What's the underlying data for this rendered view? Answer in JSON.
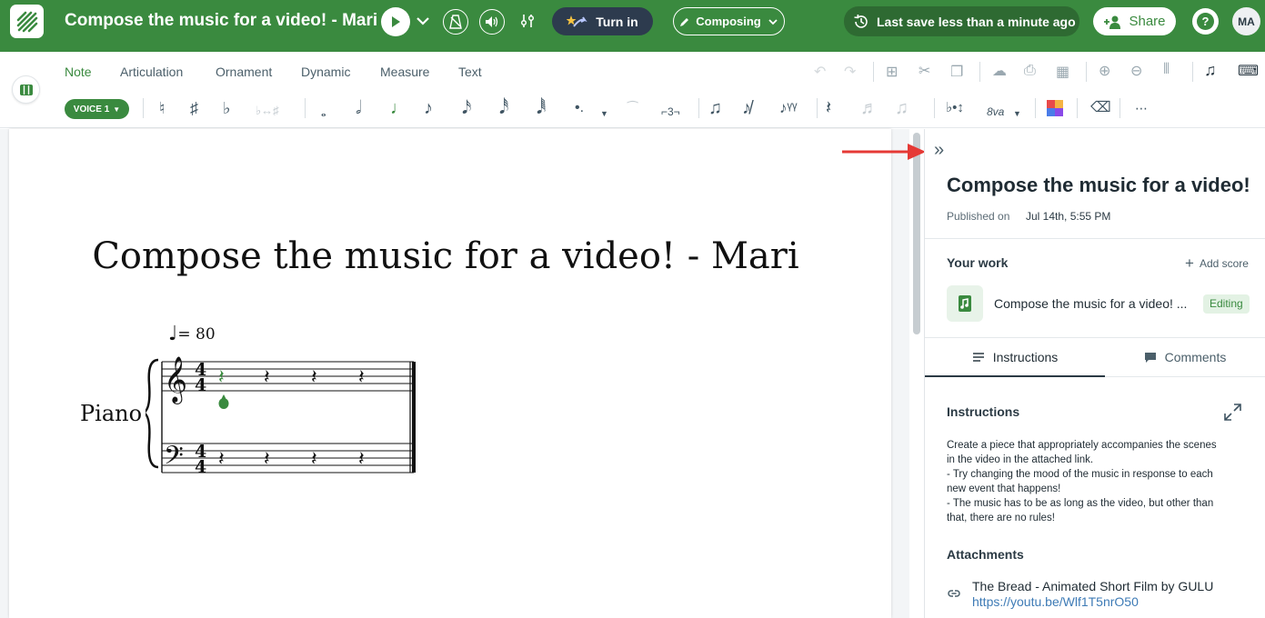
{
  "topbar": {
    "title": "Compose the music for a video! - Mari",
    "turn_in": "Turn in",
    "composing": "Composing",
    "last_save": "Last save less than a minute ago",
    "share": "Share",
    "help": "?",
    "avatar": "MA"
  },
  "tabs": [
    "Note",
    "Articulation",
    "Ornament",
    "Dynamic",
    "Measure",
    "Text"
  ],
  "palette": {
    "voice": "VOICE 1",
    "tuplet": "⌐3¬",
    "ottava": "8va"
  },
  "score": {
    "title": "Compose the music for a video! - Mari",
    "tempo": "= 80",
    "instrument": "Piano",
    "time_sig_top": "4",
    "time_sig_bottom": "4"
  },
  "panel": {
    "collapse": "»",
    "title": "Compose the music for a video!",
    "published_label": "Published on",
    "published_date": "Jul 14th, 5:55 PM",
    "your_work": "Your work",
    "add_score": "Add score",
    "work_item": "Compose the music for a video! ...",
    "work_badge": "Editing",
    "tab_instructions": "Instructions",
    "tab_comments": "Comments",
    "instructions_heading": "Instructions",
    "instructions_text": [
      "Create a piece that appropriately accompanies the scenes",
      "in the video in the attached link.",
      "- Try changing the mood of the music in response to each",
      "new event that happens!",
      "- The music has to be as long as the video, but other than",
      "that, there are no rules!"
    ],
    "attachments_heading": "Attachments",
    "attachment_title": "The Bread - Animated Short Film by GULU",
    "attachment_url": "https://youtu.be/Wlf1T5nrO50"
  },
  "colors": {
    "brand_green": "#3a8a3f",
    "dark_pill": "#2d3b4e",
    "annotation_arrow": "#e53935"
  }
}
